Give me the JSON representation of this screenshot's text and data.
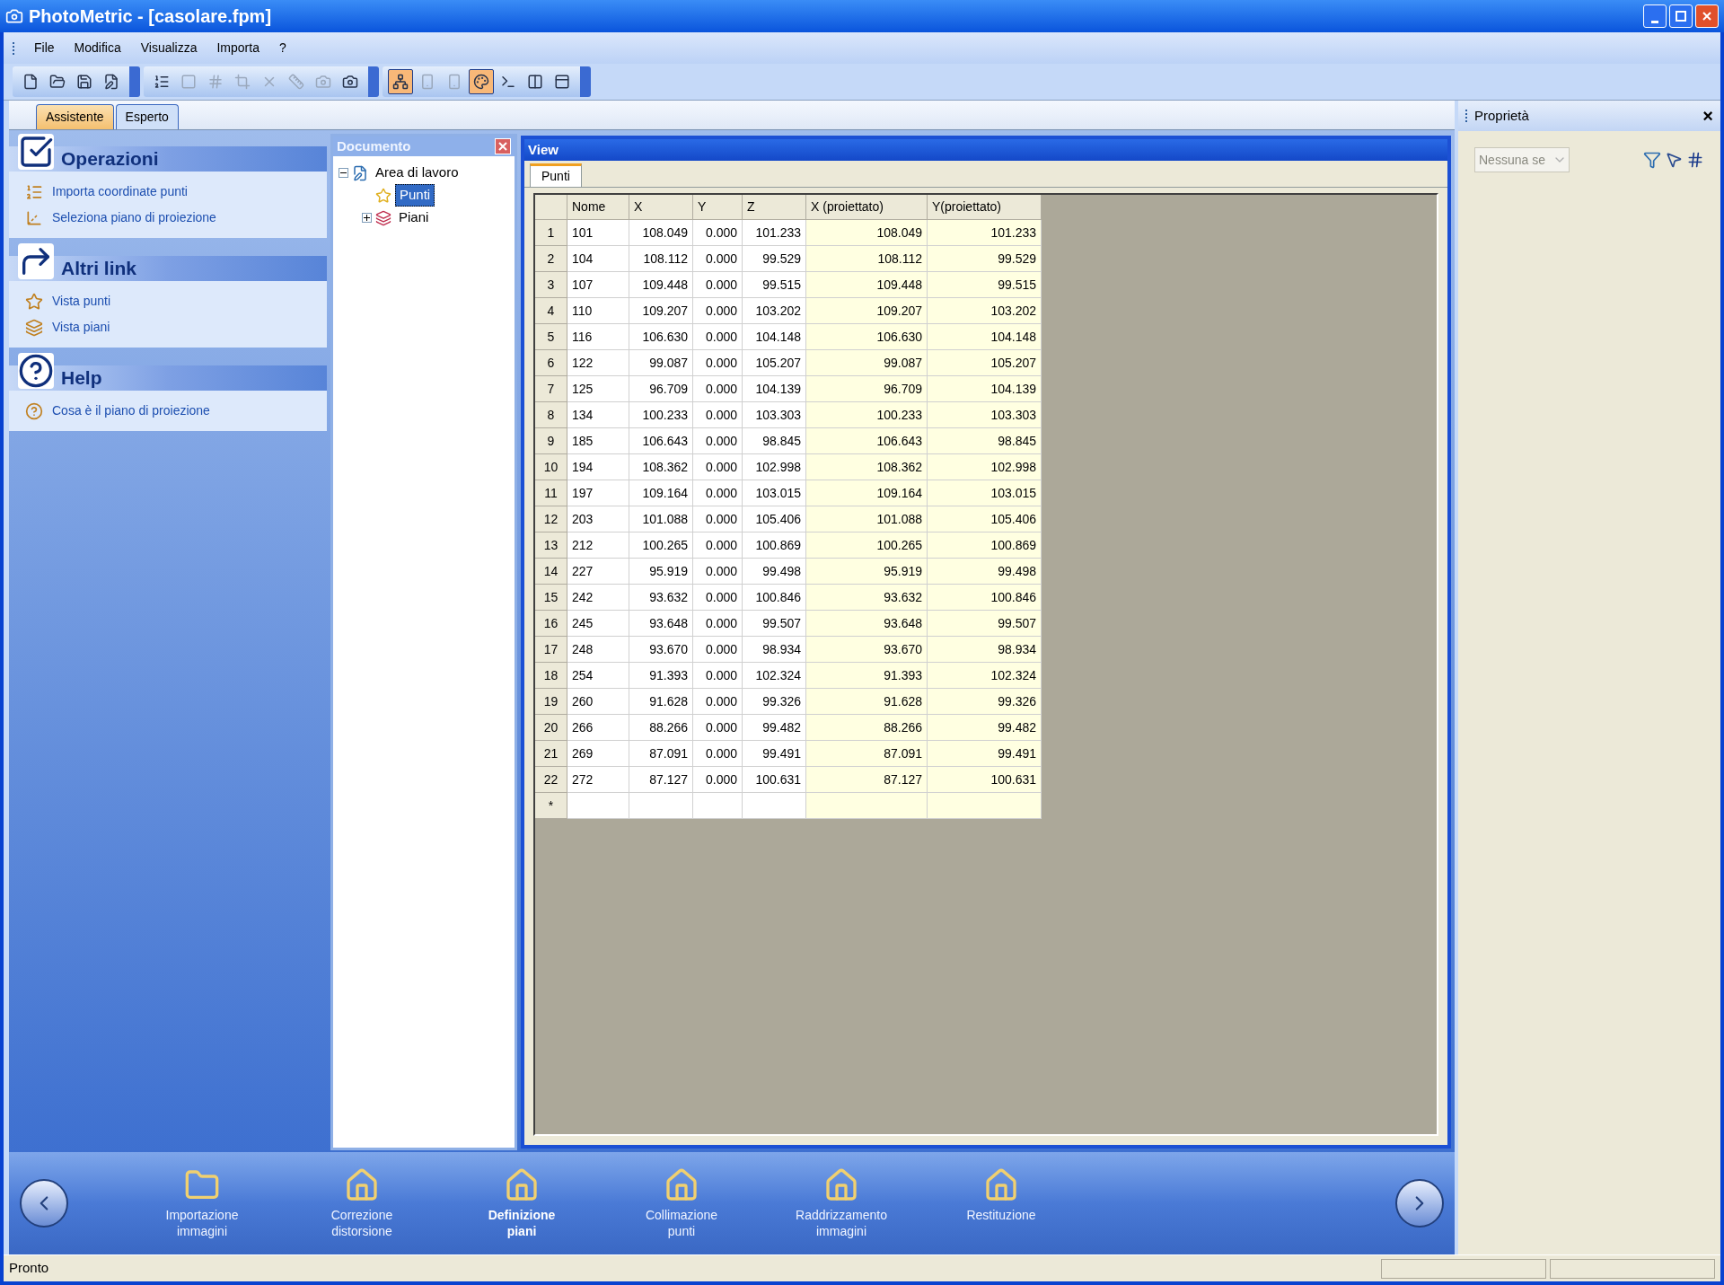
{
  "window": {
    "title": "PhotoMetric - [casolare.fpm]"
  },
  "menu": [
    "File",
    "Modifica",
    "Visualizza",
    "Importa",
    "?"
  ],
  "toolbar": [
    [
      {
        "pressed": false,
        "disabled": false
      },
      {
        "pressed": false,
        "disabled": false
      },
      {
        "pressed": false,
        "disabled": false
      },
      {
        "pressed": false,
        "disabled": false
      }
    ],
    [
      {
        "pressed": false,
        "disabled": false
      },
      {
        "pressed": false,
        "disabled": true
      },
      {
        "pressed": false,
        "disabled": true
      },
      {
        "pressed": false,
        "disabled": true
      },
      {
        "pressed": false,
        "disabled": true
      },
      {
        "pressed": false,
        "disabled": true
      },
      {
        "pressed": false,
        "disabled": true
      },
      {
        "pressed": false,
        "disabled": false
      }
    ],
    [
      {
        "pressed": true,
        "disabled": false
      },
      {
        "pressed": false,
        "disabled": true
      },
      {
        "pressed": false,
        "disabled": true
      },
      {
        "pressed": true,
        "disabled": false
      },
      {
        "pressed": false,
        "disabled": false
      },
      {
        "pressed": false,
        "disabled": false
      },
      {
        "pressed": false,
        "disabled": false
      }
    ]
  ],
  "mode_tabs": [
    {
      "label": "Assistente",
      "selected": true
    },
    {
      "label": "Esperto",
      "selected": false
    }
  ],
  "task_sections": [
    {
      "title": "Operazioni",
      "links": [
        "Importa coordinate punti",
        "Seleziona piano di proiezione"
      ]
    },
    {
      "title": "Altri link",
      "links": [
        "Vista punti",
        "Vista piani"
      ]
    },
    {
      "title": "Help",
      "links": [
        "Cosa è il piano di proiezione"
      ]
    }
  ],
  "document_panel": {
    "title": "Documento",
    "tree": [
      {
        "label": "Area di lavoro",
        "expanded": true,
        "selected": false,
        "children": [
          {
            "label": "Punti",
            "selected": true
          },
          {
            "label": "Piani",
            "expanded": false,
            "selected": false
          }
        ]
      }
    ]
  },
  "view": {
    "title": "View",
    "tabs": [
      {
        "label": "Punti",
        "selected": true
      }
    ],
    "table": {
      "columns": [
        "",
        "Nome",
        "X",
        "Y",
        "Z",
        "X (proiettato)",
        "Y(proiettato)"
      ],
      "new_row_marker": "*",
      "rows": [
        [
          "1",
          "101",
          "108.049",
          "0.000",
          "101.233",
          "108.049",
          "101.233"
        ],
        [
          "2",
          "104",
          "108.112",
          "0.000",
          "99.529",
          "108.112",
          "99.529"
        ],
        [
          "3",
          "107",
          "109.448",
          "0.000",
          "99.515",
          "109.448",
          "99.515"
        ],
        [
          "4",
          "110",
          "109.207",
          "0.000",
          "103.202",
          "109.207",
          "103.202"
        ],
        [
          "5",
          "116",
          "106.630",
          "0.000",
          "104.148",
          "106.630",
          "104.148"
        ],
        [
          "6",
          "122",
          "99.087",
          "0.000",
          "105.207",
          "99.087",
          "105.207"
        ],
        [
          "7",
          "125",
          "96.709",
          "0.000",
          "104.139",
          "96.709",
          "104.139"
        ],
        [
          "8",
          "134",
          "100.233",
          "0.000",
          "103.303",
          "100.233",
          "103.303"
        ],
        [
          "9",
          "185",
          "106.643",
          "0.000",
          "98.845",
          "106.643",
          "98.845"
        ],
        [
          "10",
          "194",
          "108.362",
          "0.000",
          "102.998",
          "108.362",
          "102.998"
        ],
        [
          "11",
          "197",
          "109.164",
          "0.000",
          "103.015",
          "109.164",
          "103.015"
        ],
        [
          "12",
          "203",
          "101.088",
          "0.000",
          "105.406",
          "101.088",
          "105.406"
        ],
        [
          "13",
          "212",
          "100.265",
          "0.000",
          "100.869",
          "100.265",
          "100.869"
        ],
        [
          "14",
          "227",
          "95.919",
          "0.000",
          "99.498",
          "95.919",
          "99.498"
        ],
        [
          "15",
          "242",
          "93.632",
          "0.000",
          "100.846",
          "93.632",
          "100.846"
        ],
        [
          "16",
          "245",
          "93.648",
          "0.000",
          "99.507",
          "93.648",
          "99.507"
        ],
        [
          "17",
          "248",
          "93.670",
          "0.000",
          "98.934",
          "93.670",
          "98.934"
        ],
        [
          "18",
          "254",
          "91.393",
          "0.000",
          "102.324",
          "91.393",
          "102.324"
        ],
        [
          "19",
          "260",
          "91.628",
          "0.000",
          "99.326",
          "91.628",
          "99.326"
        ],
        [
          "20",
          "266",
          "88.266",
          "0.000",
          "99.482",
          "88.266",
          "99.482"
        ],
        [
          "21",
          "269",
          "87.091",
          "0.000",
          "99.491",
          "87.091",
          "99.491"
        ],
        [
          "22",
          "272",
          "87.127",
          "0.000",
          "100.631",
          "87.127",
          "100.631"
        ]
      ]
    }
  },
  "properties_panel": {
    "title": "Proprietà",
    "close": "×",
    "selector": {
      "value": "Nessuna se"
    }
  },
  "workflow_steps": [
    {
      "label": "Importazione\nimmagini",
      "selected": false
    },
    {
      "label": "Correzione\ndistorsione",
      "selected": false
    },
    {
      "label": "Definizione\npiani",
      "selected": true
    },
    {
      "label": "Collimazione\npunti",
      "selected": false
    },
    {
      "label": "Raddrizzamento\nimmagini",
      "selected": false
    },
    {
      "label": "Restituzione",
      "selected": false
    }
  ],
  "status_bar": {
    "text": "Pronto"
  }
}
